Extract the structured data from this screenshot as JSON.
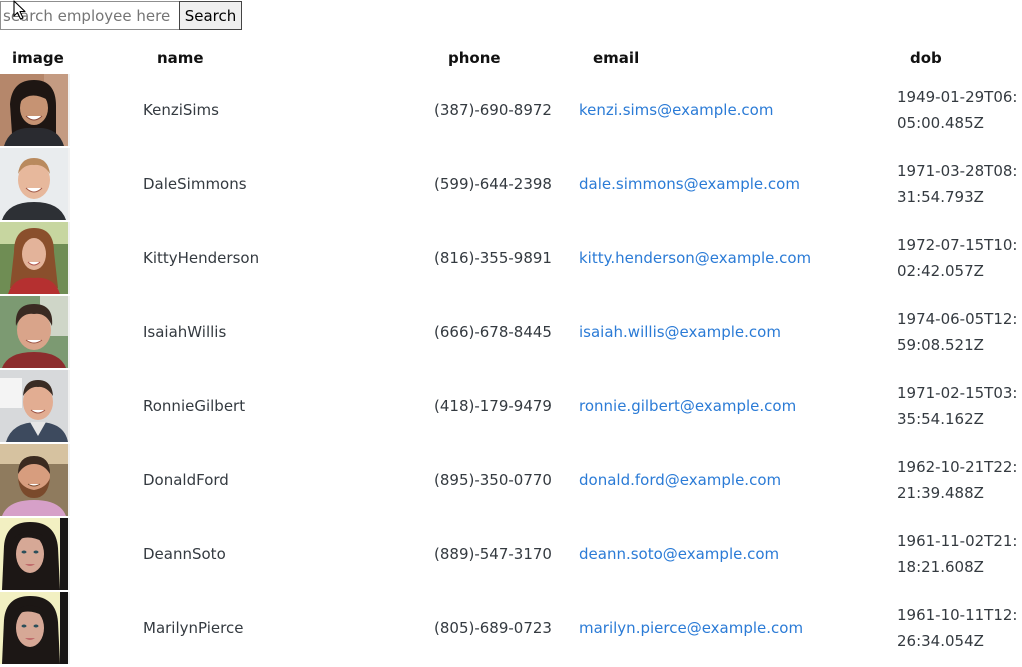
{
  "search": {
    "placeholder": "search employee here",
    "button_label": "Search"
  },
  "table": {
    "headers": {
      "image": "image",
      "name": "name",
      "phone": "phone",
      "email": "email",
      "dob": "dob"
    },
    "rows": [
      {
        "name": "KenziSims",
        "phone": "(387)-690-8972",
        "email": "kenzi.sims@example.com",
        "dob": "1949-01-29T06:05:00.485Z",
        "avatar": "woman-dark-hair-portrait"
      },
      {
        "name": "DaleSimmons",
        "phone": "(599)-644-2398",
        "email": "dale.simmons@example.com",
        "dob": "1971-03-28T08:31:54.793Z",
        "avatar": "man-short-hair-portrait"
      },
      {
        "name": "KittyHenderson",
        "phone": "(816)-355-9891",
        "email": "kitty.henderson@example.com",
        "dob": "1972-07-15T10:02:42.057Z",
        "avatar": "woman-long-hair-portrait"
      },
      {
        "name": "IsaiahWillis",
        "phone": "(666)-678-8445",
        "email": "isaiah.willis@example.com",
        "dob": "1974-06-05T12:59:08.521Z",
        "avatar": "man-dark-hair-portrait"
      },
      {
        "name": "RonnieGilbert",
        "phone": "(418)-179-9479",
        "email": "ronnie.gilbert@example.com",
        "dob": "1971-02-15T03:35:54.162Z",
        "avatar": "man-office-portrait"
      },
      {
        "name": "DonaldFord",
        "phone": "(895)-350-0770",
        "email": "donald.ford@example.com",
        "dob": "1962-10-21T22:21:39.488Z",
        "avatar": "man-beard-portrait"
      },
      {
        "name": "DeannSoto",
        "phone": "(889)-547-3170",
        "email": "deann.soto@example.com",
        "dob": "1961-11-02T21:18:21.608Z",
        "avatar": "woman-selfie-portrait"
      },
      {
        "name": "MarilynPierce",
        "phone": "(805)-689-0723",
        "email": "marilyn.pierce@example.com",
        "dob": "1961-10-11T12:26:34.054Z",
        "avatar": "woman-selfie-portrait"
      }
    ]
  }
}
